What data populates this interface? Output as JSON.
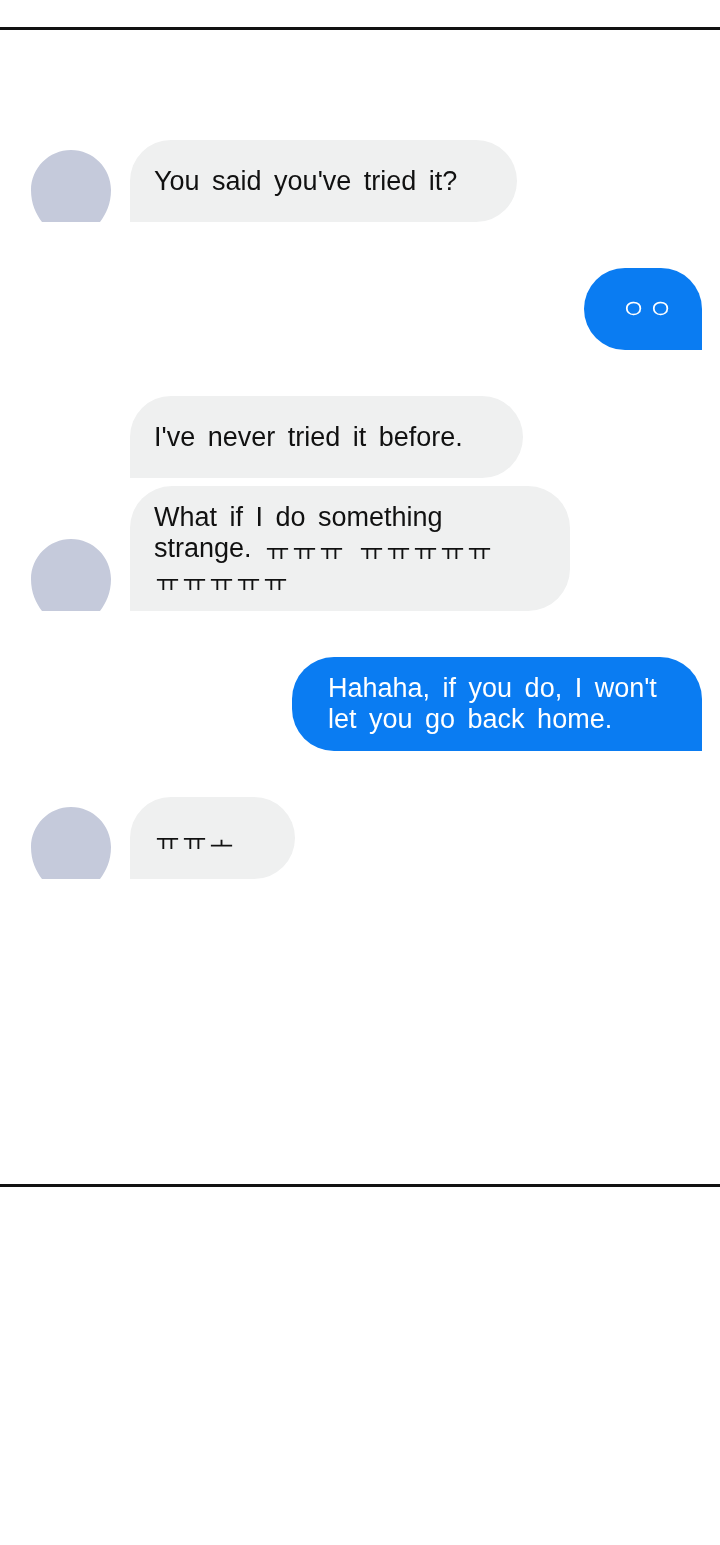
{
  "groups": [
    {
      "kind": "received",
      "messages": [
        "You said you've tried it?"
      ]
    },
    {
      "kind": "sent",
      "messages": [
        "ㅇㅇ"
      ]
    },
    {
      "kind": "received",
      "messages": [
        "I've never tried it before.",
        "What if I do something strange. ㅠㅠㅠ ㅠㅠㅠㅠㅠㅠㅠㅠㅠㅠ"
      ]
    },
    {
      "kind": "sent",
      "messages": [
        "Hahaha, if you do, I won't let you go back home."
      ]
    },
    {
      "kind": "received",
      "messages": [
        "ㅠㅠㅗ"
      ]
    }
  ]
}
